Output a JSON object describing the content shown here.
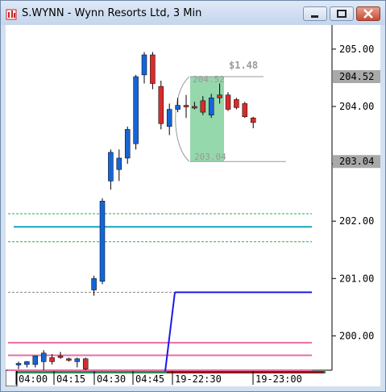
{
  "window": {
    "title": "S.WYNN - Wynn Resorts Ltd, 3 Min",
    "buttons": [
      "minimize",
      "restore",
      "close"
    ]
  },
  "chart": {
    "price_labels": [
      "205.00",
      "204.00",
      "203.00",
      "202.00",
      "201.00",
      "200.00"
    ],
    "highlighted_prices": [
      "204.52",
      "203.04"
    ],
    "time_labels": [
      "04:00",
      "04:15",
      "04:30",
      "04:45",
      "19-22:30",
      "19-23:00"
    ],
    "measure": {
      "delta": "$1.48",
      "top": "204.52",
      "bottom": "203.04"
    }
  },
  "chart_data": {
    "type": "candlestick",
    "symbol": "S.WYNN",
    "interval": "3 Min",
    "ylim": [
      199.35,
      205.35
    ],
    "candles": [
      {
        "o": 199.5,
        "h": 199.55,
        "l": 199.42,
        "c": 199.52,
        "dir": "up"
      },
      {
        "o": 199.5,
        "h": 199.56,
        "l": 199.45,
        "c": 199.55,
        "dir": "up"
      },
      {
        "o": 199.5,
        "h": 199.62,
        "l": 199.45,
        "c": 199.65,
        "dir": "up"
      },
      {
        "o": 199.55,
        "h": 199.75,
        "l": 199.4,
        "c": 199.7,
        "dir": "up"
      },
      {
        "o": 199.62,
        "h": 199.68,
        "l": 199.5,
        "c": 199.55,
        "dir": "down"
      },
      {
        "o": 199.65,
        "h": 199.72,
        "l": 199.6,
        "c": 199.63,
        "dir": "down"
      },
      {
        "o": 199.6,
        "h": 199.62,
        "l": 199.55,
        "c": 199.58,
        "dir": "down"
      },
      {
        "o": 199.55,
        "h": 199.62,
        "l": 199.45,
        "c": 199.6,
        "dir": "up"
      },
      {
        "o": 199.6,
        "h": 199.62,
        "l": 199.4,
        "c": 199.42,
        "dir": "down"
      },
      {
        "o": 200.8,
        "h": 201.05,
        "l": 200.7,
        "c": 201.0,
        "dir": "up"
      },
      {
        "o": 200.95,
        "h": 202.4,
        "l": 200.9,
        "c": 202.35,
        "dir": "up"
      },
      {
        "o": 202.7,
        "h": 203.25,
        "l": 202.55,
        "c": 203.2,
        "dir": "up"
      },
      {
        "o": 202.9,
        "h": 203.25,
        "l": 202.7,
        "c": 203.1,
        "dir": "up"
      },
      {
        "o": 203.1,
        "h": 203.65,
        "l": 203.0,
        "c": 203.6,
        "dir": "up"
      },
      {
        "o": 203.35,
        "h": 204.55,
        "l": 203.25,
        "c": 204.52,
        "dir": "up"
      },
      {
        "o": 204.55,
        "h": 204.95,
        "l": 204.4,
        "c": 204.9,
        "dir": "up"
      },
      {
        "o": 204.9,
        "h": 204.95,
        "l": 204.3,
        "c": 204.4,
        "dir": "down"
      },
      {
        "o": 204.35,
        "h": 204.45,
        "l": 203.6,
        "c": 203.7,
        "dir": "down"
      },
      {
        "o": 203.65,
        "h": 204.05,
        "l": 203.5,
        "c": 203.95,
        "dir": "up"
      },
      {
        "o": 203.95,
        "h": 204.15,
        "l": 203.9,
        "c": 204.02,
        "dir": "up"
      },
      {
        "o": 204.0,
        "h": 204.2,
        "l": 203.8,
        "c": 204.02,
        "dir": "down"
      },
      {
        "o": 204.0,
        "h": 204.08,
        "l": 203.95,
        "c": 203.98,
        "dir": "down"
      },
      {
        "o": 204.1,
        "h": 204.18,
        "l": 203.85,
        "c": 203.9,
        "dir": "down"
      },
      {
        "o": 203.85,
        "h": 204.22,
        "l": 203.8,
        "c": 204.15,
        "dir": "up"
      },
      {
        "o": 204.15,
        "h": 204.4,
        "l": 204.05,
        "c": 204.2,
        "dir": "down"
      },
      {
        "o": 204.2,
        "h": 204.25,
        "l": 203.92,
        "c": 203.95,
        "dir": "down"
      },
      {
        "o": 204.12,
        "h": 204.15,
        "l": 203.95,
        "c": 203.98,
        "dir": "down"
      },
      {
        "o": 204.05,
        "h": 204.08,
        "l": 203.8,
        "c": 203.82,
        "dir": "down"
      },
      {
        "o": 203.8,
        "h": 203.82,
        "l": 203.62,
        "c": 203.72,
        "dir": "down"
      }
    ],
    "horizontal_lines": [
      {
        "value": 202.13,
        "color": "#22b14c",
        "style": "dashed"
      },
      {
        "value": 201.9,
        "color": "#17a5c2",
        "style": "solid"
      },
      {
        "value": 201.64,
        "color": "#22b14c",
        "style": "dashed"
      },
      {
        "value": 200.76,
        "color": "#888888",
        "style": "dashed"
      },
      {
        "value": 200.76,
        "color": "#1a1ae8",
        "style": "solid"
      },
      {
        "value": 199.88,
        "color": "#e76fa4",
        "style": "solid"
      },
      {
        "value": 199.66,
        "color": "#e76fa4",
        "style": "solid"
      },
      {
        "value": 199.4,
        "color": "#e76fa4",
        "style": "solid"
      }
    ],
    "colors": {
      "up": "#1565d8",
      "down": "#d62c2c",
      "measure_fill": "#8fd6a8",
      "axis_highlight": "#a9a9a9"
    }
  }
}
